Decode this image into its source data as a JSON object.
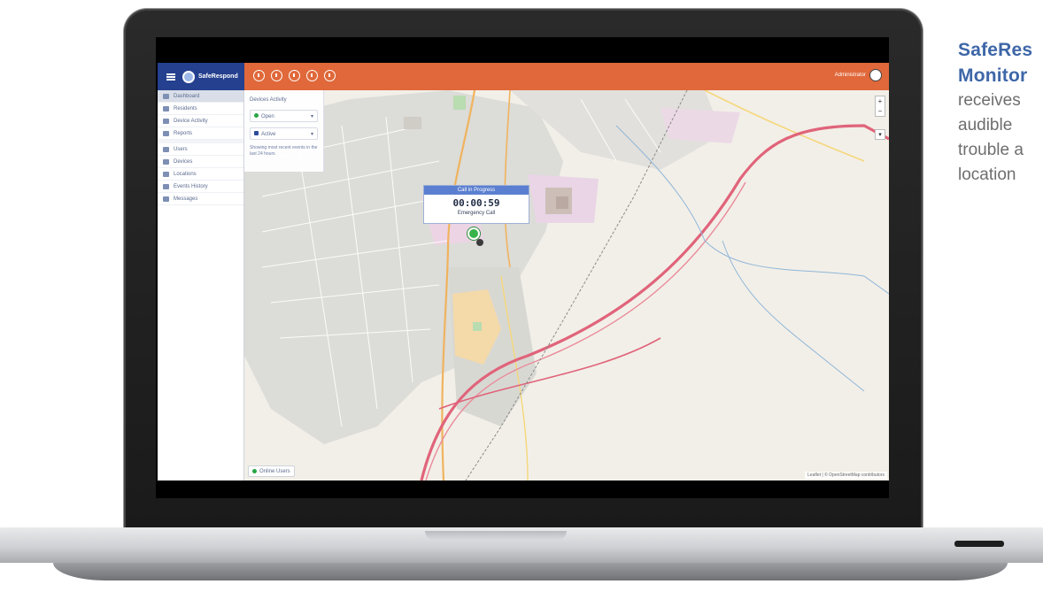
{
  "app": {
    "brand_name": "SafeRespond",
    "user_name": "Administrator"
  },
  "toolbar": {
    "icons": [
      "bell-icon",
      "clock-icon",
      "alert-icon",
      "share-icon",
      "settings-icon"
    ]
  },
  "sidebar": {
    "items": [
      {
        "label": "Dashboard",
        "active": true
      },
      {
        "label": "Residents"
      },
      {
        "label": "Device Activity"
      },
      {
        "label": "Reports"
      },
      {
        "label": "Users"
      },
      {
        "label": "Devices"
      },
      {
        "label": "Locations"
      },
      {
        "label": "Events History"
      },
      {
        "label": "Messages"
      }
    ]
  },
  "filters": {
    "title": "Devices Activity",
    "select_1": "Open",
    "select_2": "Active",
    "note": "Showing most recent events in the last 24 hours"
  },
  "popup": {
    "header": "Call in Progress",
    "timer": "00:00:59",
    "subtitle": "Emergency Call"
  },
  "map": {
    "zoom_in": "+",
    "zoom_out": "−",
    "layers": "▾",
    "status_chip": "Online Users",
    "attribution": "Leaflet | © OpenStreetMap contributors"
  },
  "marketing": {
    "headline_line1": "SafeRes",
    "headline_line2": "Monitor",
    "body_lines": [
      "receives",
      "audible",
      "trouble a",
      "location"
    ]
  },
  "colors": {
    "topbar": "#e0683a",
    "brand_block": "#24408e",
    "headline": "#3e67a8",
    "marker": "#38b34a"
  }
}
